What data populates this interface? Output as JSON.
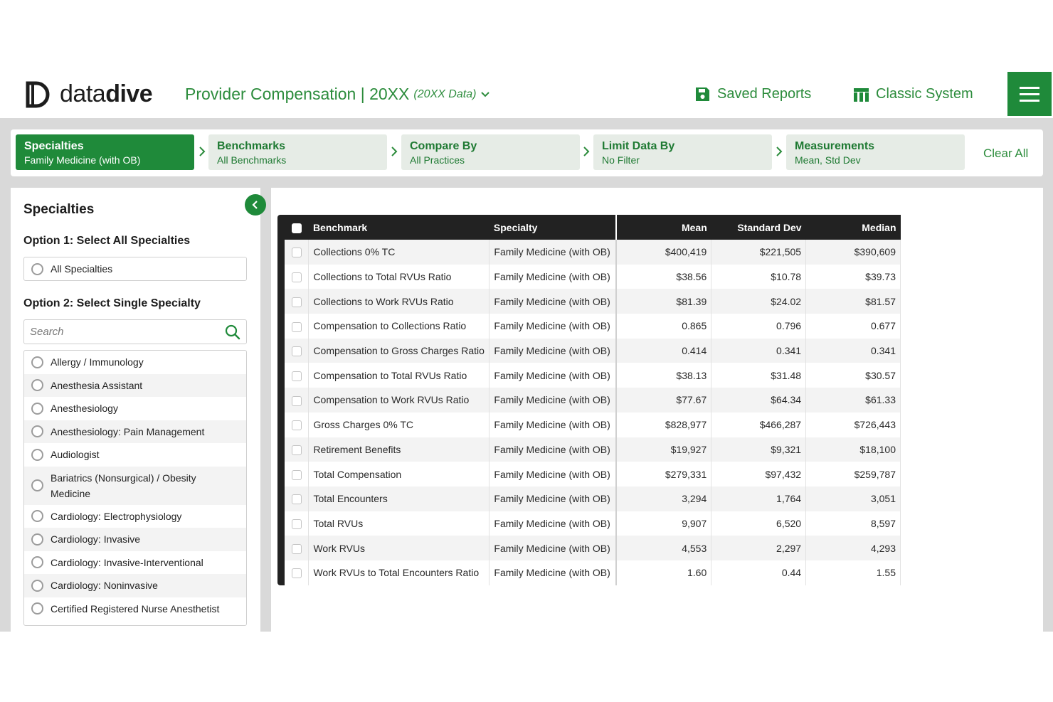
{
  "header": {
    "logo_text_light": "data",
    "logo_text_bold": "dive",
    "product_title": "Provider Compensation | 20XX",
    "product_subtitle": "(20XX Data)",
    "saved_reports": "Saved Reports",
    "classic_system": "Classic System"
  },
  "steps": [
    {
      "title": "Specialties",
      "value": "Family Medicine (with OB)"
    },
    {
      "title": "Benchmarks",
      "value": "All Benchmarks"
    },
    {
      "title": "Compare By",
      "value": "All Practices"
    },
    {
      "title": "Limit Data By",
      "value": "No Filter"
    },
    {
      "title": "Measurements",
      "value": "Mean, Std Dev"
    }
  ],
  "clear_all": "Clear All",
  "sidebar": {
    "title": "Specialties",
    "option1_label": "Option 1: Select All Specialties",
    "all_specialties": "All Specialties",
    "option2_label": "Option 2: Select Single Specialty",
    "search_placeholder": "Search",
    "items": [
      "Allergy / Immunology",
      "Anesthesia Assistant",
      "Anesthesiology",
      "Anesthesiology: Pain Management",
      "Audiologist",
      "Bariatrics (Nonsurgical) / Obesity Medicine",
      "Cardiology: Electrophysiology",
      "Cardiology: Invasive",
      "Cardiology: Invasive-Interventional",
      "Cardiology: Noninvasive",
      "Certified Registered Nurse Anesthetist"
    ]
  },
  "table": {
    "headers": {
      "benchmark": "Benchmark",
      "specialty": "Specialty",
      "mean": "Mean",
      "std_dev": "Standard Dev",
      "median": "Median"
    },
    "rows": [
      {
        "benchmark": "Collections 0% TC",
        "specialty": "Family Medicine (with OB)",
        "mean": "$400,419",
        "std_dev": "$221,505",
        "median": "$390,609"
      },
      {
        "benchmark": "Collections to Total RVUs Ratio",
        "specialty": "Family Medicine (with OB)",
        "mean": "$38.56",
        "std_dev": "$10.78",
        "median": "$39.73"
      },
      {
        "benchmark": "Collections to Work RVUs Ratio",
        "specialty": "Family Medicine (with OB)",
        "mean": "$81.39",
        "std_dev": "$24.02",
        "median": "$81.57"
      },
      {
        "benchmark": "Compensation to Collections Ratio",
        "specialty": "Family Medicine (with OB)",
        "mean": "0.865",
        "std_dev": "0.796",
        "median": "0.677"
      },
      {
        "benchmark": "Compensation to Gross Charges Ratio",
        "specialty": "Family Medicine (with OB)",
        "mean": "0.414",
        "std_dev": "0.341",
        "median": "0.341"
      },
      {
        "benchmark": "Compensation to Total RVUs Ratio",
        "specialty": "Family Medicine (with OB)",
        "mean": "$38.13",
        "std_dev": "$31.48",
        "median": "$30.57"
      },
      {
        "benchmark": "Compensation to Work RVUs Ratio",
        "specialty": "Family Medicine (with OB)",
        "mean": "$77.67",
        "std_dev": "$64.34",
        "median": "$61.33"
      },
      {
        "benchmark": "Gross Charges 0% TC",
        "specialty": "Family Medicine (with OB)",
        "mean": "$828,977",
        "std_dev": "$466,287",
        "median": "$726,443"
      },
      {
        "benchmark": "Retirement Benefits",
        "specialty": "Family Medicine (with OB)",
        "mean": "$19,927",
        "std_dev": "$9,321",
        "median": "$18,100"
      },
      {
        "benchmark": "Total Compensation",
        "specialty": "Family Medicine (with OB)",
        "mean": "$279,331",
        "std_dev": "$97,432",
        "median": "$259,787"
      },
      {
        "benchmark": "Total Encounters",
        "specialty": "Family Medicine (with OB)",
        "mean": "3,294",
        "std_dev": "1,764",
        "median": "3,051"
      },
      {
        "benchmark": "Total RVUs",
        "specialty": "Family Medicine (with OB)",
        "mean": "9,907",
        "std_dev": "6,520",
        "median": "8,597"
      },
      {
        "benchmark": "Work RVUs",
        "specialty": "Family Medicine (with OB)",
        "mean": "4,553",
        "std_dev": "2,297",
        "median": "4,293"
      },
      {
        "benchmark": "Work RVUs to Total Encounters Ratio",
        "specialty": "Family Medicine (with OB)",
        "mean": "1.60",
        "std_dev": "0.44",
        "median": "1.55"
      }
    ]
  },
  "colors": {
    "brand_green": "#1f8a3a",
    "text_green": "#2c8c3c",
    "table_header": "#222222"
  }
}
